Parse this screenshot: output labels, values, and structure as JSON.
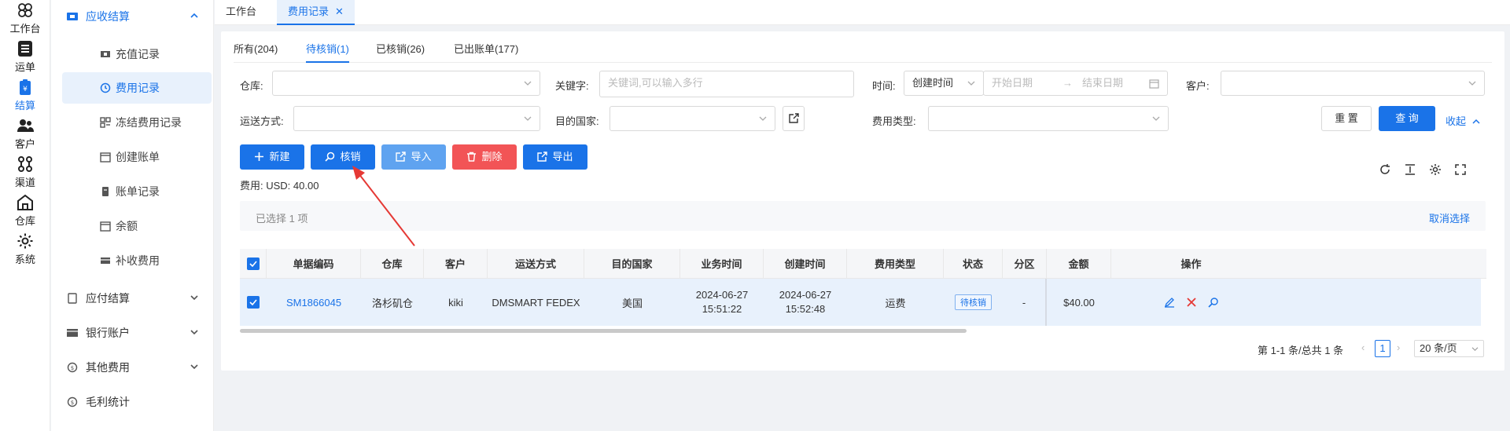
{
  "rail": {
    "items": [
      {
        "label": "工作台",
        "icon": "clover-icon"
      },
      {
        "label": "运单",
        "icon": "list-icon"
      },
      {
        "label": "结算",
        "icon": "wallet-icon"
      },
      {
        "label": "客户",
        "icon": "users-icon"
      },
      {
        "label": "渠道",
        "icon": "route-icon"
      },
      {
        "label": "仓库",
        "icon": "warehouse-icon"
      },
      {
        "label": "系统",
        "icon": "gear-icon"
      }
    ]
  },
  "submenu": {
    "group_receivable": "应收结算",
    "items": [
      "充值记录",
      "费用记录",
      "冻结费用记录",
      "创建账单",
      "账单记录",
      "余额",
      "补收费用"
    ],
    "group_payable": "应付结算",
    "group_bank": "银行账户",
    "group_other": "其他费用",
    "group_profit": "毛利统计"
  },
  "page_tabs": {
    "workbench": "工作台",
    "fee_records": "费用记录",
    "close": "✕"
  },
  "status_tabs": [
    "所有(204)",
    "待核销(1)",
    "已核销(26)",
    "已出账单(177)"
  ],
  "filters": {
    "warehouse_label": "仓库:",
    "keyword_label": "关键字:",
    "keyword_placeholder": "关键词,可以输入多行",
    "time_label": "时间:",
    "time_type": "创建时间",
    "start_placeholder": "开始日期",
    "arrow": "→",
    "end_placeholder": "结束日期",
    "customer_label": "客户:",
    "shipping_label": "运送方式:",
    "country_label": "目的国家:",
    "fee_type_label": "费用类型:",
    "reset": "重 置",
    "search": "查 询",
    "collapse": "收起"
  },
  "actions": {
    "new": "新建",
    "verify": "核销",
    "import": "导入",
    "delete": "删除",
    "export": "导出"
  },
  "fee_total": "费用: USD: 40.00",
  "selection": {
    "text": "已选择  1  项",
    "cancel": "取消选择"
  },
  "table": {
    "headers": [
      "单据编码",
      "仓库",
      "客户",
      "运送方式",
      "目的国家",
      "业务时间",
      "创建时间",
      "费用类型",
      "状态",
      "分区",
      "金额",
      "操作"
    ],
    "row": {
      "code": "SM1866045",
      "warehouse": "洛杉矶仓",
      "customer": "kiki",
      "shipping": "DMSMART FEDEX",
      "country": "美国",
      "biz_date": "2024-06-27",
      "biz_time": "15:51:22",
      "create_date": "2024-06-27",
      "create_time": "15:52:48",
      "fee_type": "运费",
      "status": "待核销",
      "zone": "-",
      "amount": "$40.00"
    }
  },
  "pager": {
    "summary": "第 1-1 条/总共 1 条",
    "prev": "‹",
    "page": "1",
    "next": "›",
    "size": "20 条/页"
  },
  "colors": {
    "primary": "#1a73e8",
    "danger": "#f25456",
    "light_primary": "#5fa3f0",
    "annotation_arrow": "#e53935"
  }
}
